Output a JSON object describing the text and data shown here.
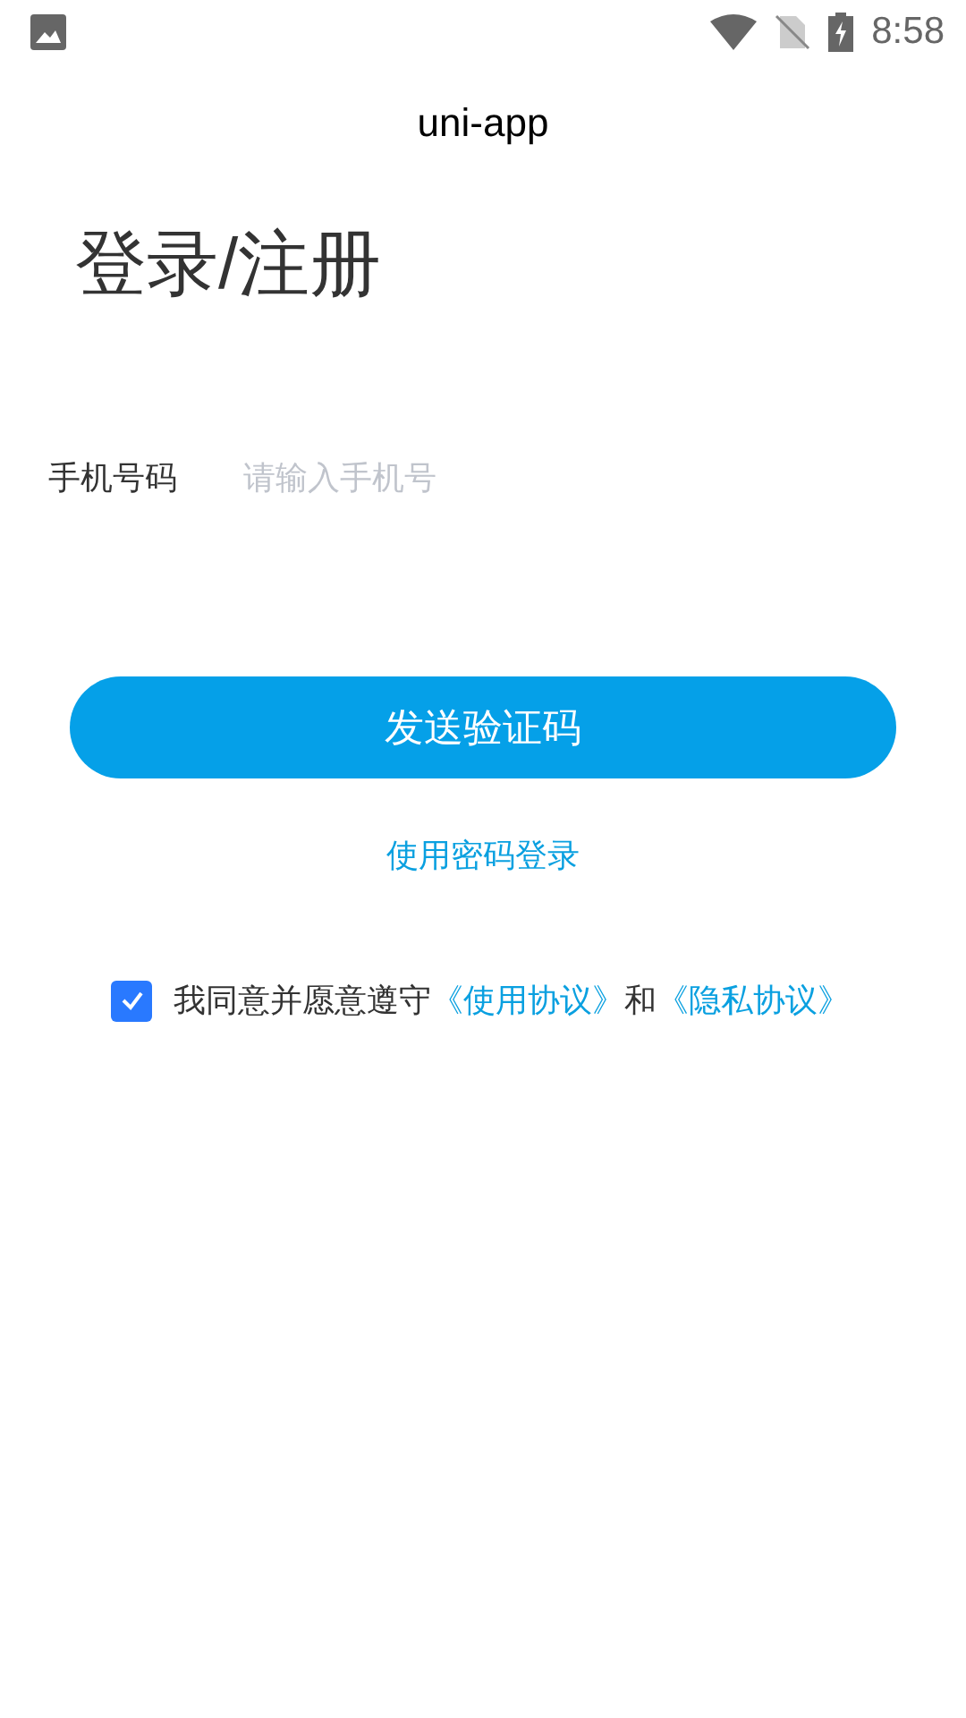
{
  "status_bar": {
    "time": "8:58"
  },
  "nav_bar": {
    "title": "uni-app"
  },
  "heading": "登录/注册",
  "phone_field": {
    "label": "手机号码",
    "placeholder": "请输入手机号"
  },
  "send_code_button": "发送验证码",
  "password_login_link": "使用密码登录",
  "agreement": {
    "checked": true,
    "parts": [
      {
        "kind": "text",
        "text": "我同意并愿意遵守"
      },
      {
        "kind": "link",
        "text": "《使用协议》"
      },
      {
        "kind": "text",
        "text": "和"
      },
      {
        "kind": "link",
        "text": "《隐私协议》"
      }
    ]
  }
}
